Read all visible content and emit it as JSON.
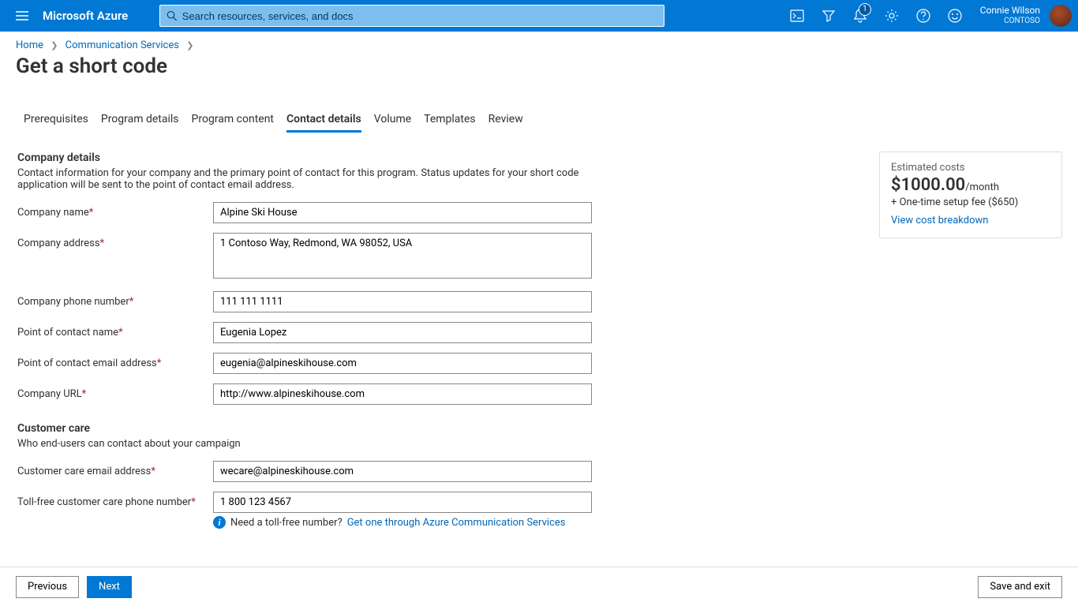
{
  "header": {
    "brand": "Microsoft Azure",
    "search_placeholder": "Search resources, services, and docs",
    "notification_count": "1",
    "user_name": "Connie Wilson",
    "tenant": "CONTOSO"
  },
  "breadcrumb": {
    "home": "Home",
    "service": "Communication Services"
  },
  "page_title": "Get a short code",
  "tabs": {
    "t0": "Prerequisites",
    "t1": "Program details",
    "t2": "Program content",
    "t3": "Contact details",
    "t4": "Volume",
    "t5": "Templates",
    "t6": "Review"
  },
  "company": {
    "section_title": "Company details",
    "section_desc": "Contact information for your company and the primary point of contact for this program. Status updates for your short code application will be sent to the point of contact email address.",
    "name_label": "Company name",
    "name_value": "Alpine Ski House",
    "address_label": "Company address",
    "address_value": "1 Contoso Way, Redmond, WA 98052, USA",
    "phone_label": "Company phone number",
    "phone_value": "111 111 1111",
    "poc_name_label": "Point of contact name",
    "poc_name_value": "Eugenia Lopez",
    "poc_email_label": "Point of contact email address",
    "poc_email_value": "eugenia@alpineskihouse.com",
    "url_label": "Company URL",
    "url_value": "http://www.alpineskihouse.com"
  },
  "care": {
    "section_title": "Customer care",
    "section_desc": "Who end-users can contact about your campaign",
    "email_label": "Customer care email address",
    "email_value": "wecare@alpineskihouse.com",
    "phone_label": "Toll-free customer care phone number",
    "phone_value": "1 800 123 4567",
    "helper_text": "Need a toll-free number? ",
    "helper_link": "Get one through Azure Communication Services"
  },
  "cost": {
    "title": "Estimated costs",
    "amount": "$1000.00",
    "period": "/month",
    "setup": "+ One-time setup fee ($650)",
    "link": "View cost breakdown"
  },
  "footer": {
    "prev": "Previous",
    "next": "Next",
    "save": "Save and exit"
  }
}
